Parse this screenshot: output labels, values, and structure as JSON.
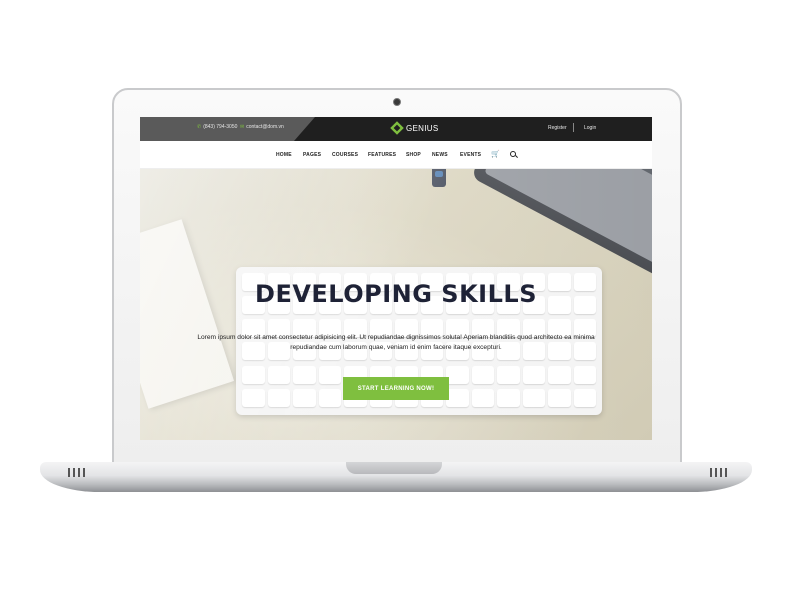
{
  "topbar": {
    "phone": "(843) 794-3050",
    "email": "contact@dom.vn",
    "logo_text": "GENIUS",
    "register": "Register",
    "login": "Login"
  },
  "nav": {
    "items": [
      "HOME",
      "PAGES",
      "COURSES",
      "FEATURES",
      "SHOP",
      "NEWS",
      "EVENTS"
    ],
    "cart_icon": "shopping-cart-icon",
    "search_icon": "search-icon"
  },
  "hero": {
    "title": "DEVELOPING SKILLS",
    "text_line1": "Lorem ipsum dolor sit amet consectetur adipisicing elit. Ut repudiandae dignissimos soluta! Aperiam blanditiis quod architecto ea minima",
    "text_line2": "repudiandae cum laborum quae, veniam id enim facere itaque excepturi.",
    "cta": "START LEARNING NOW!"
  },
  "colors": {
    "accent": "#7fbf3f",
    "topbar": "#1f1f1f",
    "title": "#1e2236"
  }
}
